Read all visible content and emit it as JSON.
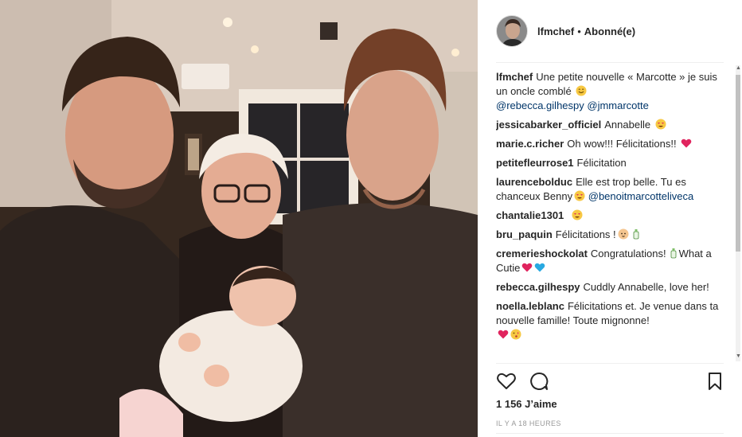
{
  "header": {
    "username": "lfmchef",
    "separator": "•",
    "follow_label": "Abonné(e)"
  },
  "comments": [
    {
      "user": "lfmchef",
      "text": "Une petite nouvelle « Marcotte » je suis un oncle comblé",
      "emoji": [
        "smiling-face-icon"
      ],
      "mentions": "@rebecca.gilhespy @jmmarcotte"
    },
    {
      "user": "jessicabarker_officiel",
      "text": "Annabelle",
      "emoji": [
        "heart-eyes-icon"
      ]
    },
    {
      "user": "marie.c.richer",
      "text": "Oh wow!!! Félicitations!!",
      "emoji": [
        "red-heart-icon"
      ]
    },
    {
      "user": "petitefleurrose1",
      "text": "Félicitation",
      "emoji": []
    },
    {
      "user": "laurencebolduc",
      "text": "Elle est trop belle. Tu es chanceux Benny",
      "emoji": [
        "heart-eyes-icon"
      ],
      "mentions": "@benoitmarcotteliveca"
    },
    {
      "user": "chantalie1301",
      "text": "",
      "emoji": [
        "heart-eyes-icon"
      ]
    },
    {
      "user": "bru_paquin",
      "text": "Félicitations !",
      "emoji": [
        "baby-face-icon",
        "baby-bottle-icon"
      ]
    },
    {
      "user": "cremerieshockolat",
      "text": "Congratulations!",
      "text2": "What a Cutie",
      "emoji": [
        "baby-bottle-icon"
      ],
      "emoji2": [
        "red-heart-icon",
        "blue-heart-icon"
      ]
    },
    {
      "user": "rebecca.gilhespy",
      "text": "Cuddly Annabelle, love her!",
      "emoji": []
    },
    {
      "user": "noella.leblanc",
      "text": "Félicitations et. Je venue dans ta nouvelle famille! Toute mignonne!",
      "emoji": [
        "red-heart-icon",
        "kissing-face-icon"
      ]
    }
  ],
  "actions": {
    "like_icon": "heart-outline-icon",
    "comment_icon": "comment-bubble-icon",
    "save_icon": "bookmark-icon"
  },
  "likes_text": "1 156 J’aime",
  "time_text": "IL Y A 18 HEURES",
  "colors": {
    "mention": "#003569",
    "text": "#262626",
    "muted": "#999999",
    "divider": "#efefef"
  }
}
